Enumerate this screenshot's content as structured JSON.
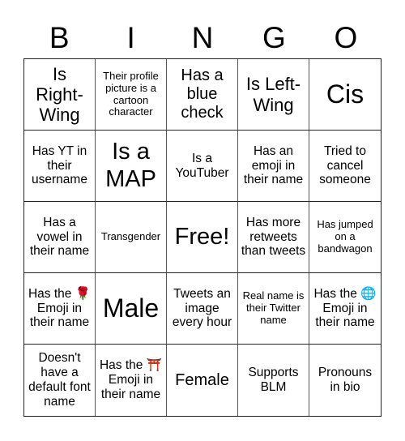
{
  "header": {
    "letters": [
      "B",
      "I",
      "N",
      "G",
      "O"
    ]
  },
  "cells": [
    "Is Right-Wing",
    "Their profile picture is a cartoon character",
    "Has a blue check",
    "Is Left-Wing",
    "Cis",
    "Has YT in their username",
    "Is a MAP",
    "Is a YouTuber",
    "Has an emoji in their name",
    "Tried to cancel someone",
    "Has a vowel in their name",
    "Transgender",
    "Free!",
    "Has more retweets than tweets",
    "Has jumped on a bandwagon",
    "Has the 🌹 Emoji in their name",
    "Male",
    "Tweets an image every hour",
    "Real name is their Twitter name",
    "Has the 🌐 Emoji in their name",
    "Doesn't have a default font name",
    "Has the ⛩️ Emoji in their name",
    "Female",
    "Supports BLM",
    "Pronouns in bio"
  ]
}
